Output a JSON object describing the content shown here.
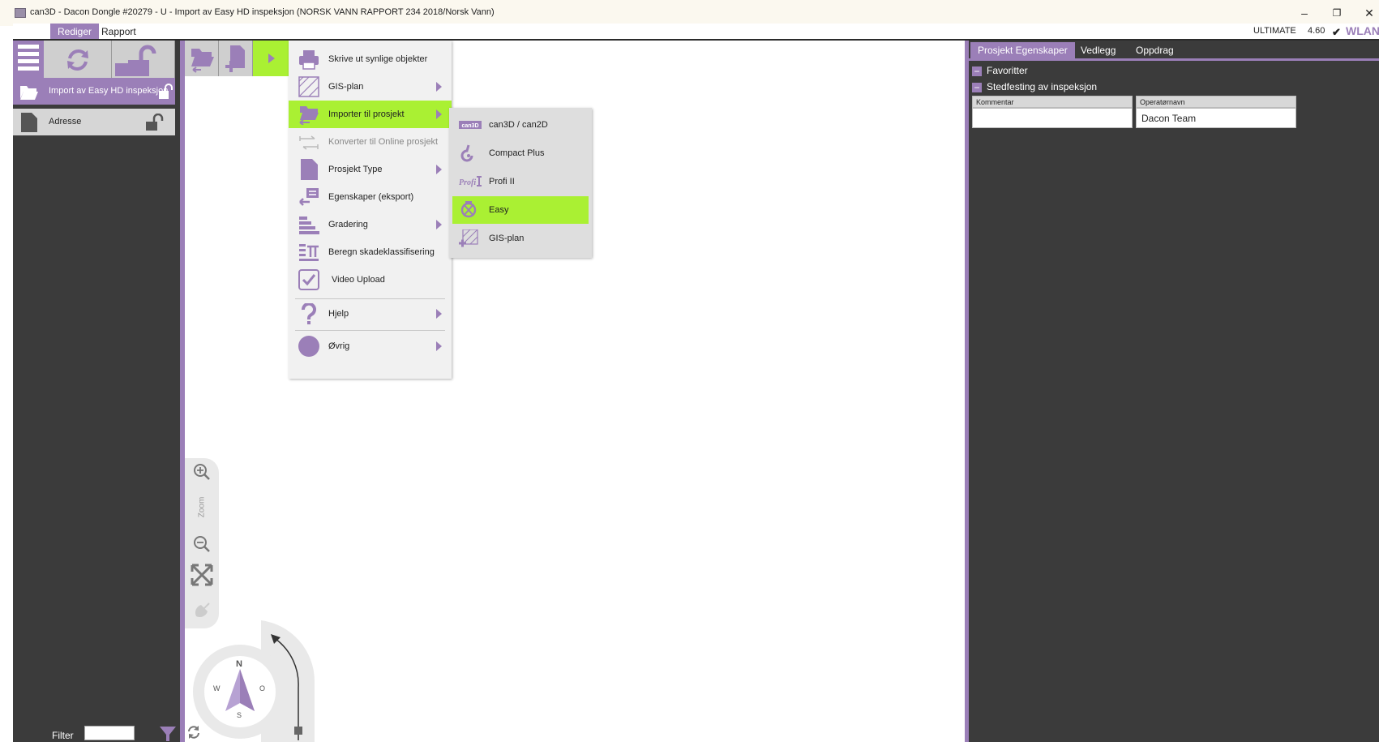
{
  "window": {
    "title": "can3D - Dacon  Dongle #20279 - U - Import av Easy HD inspeksjon (NORSK VANN RAPPORT 234 2018/Norsk Vann)",
    "controls": [
      "–",
      "❐",
      "✕"
    ]
  },
  "ribbon": {
    "tabs": [
      "Rediger",
      "Rapport"
    ],
    "edition": "ULTIMATE",
    "version": "4.60",
    "network": "WLAN"
  },
  "left_panel": {
    "items": [
      {
        "label": "Import av Easy HD inspeksjon",
        "icon": "folder-open-icon",
        "active": true
      },
      {
        "label": "Adresse",
        "icon": "document-icon",
        "active": false
      }
    ],
    "filter_label": "Filter",
    "filter_value": ""
  },
  "main_menu": {
    "items": [
      {
        "label": "Skrive ut synlige objekter",
        "icon": "printer-icon",
        "submenu": false
      },
      {
        "label": "GIS-plan",
        "icon": "gis-plan-icon",
        "submenu": true
      },
      {
        "label": "Importer til prosjekt",
        "icon": "import-icon",
        "submenu": true,
        "highlighted": true
      },
      {
        "label": "Konverter til Online prosjekt",
        "icon": "convert-icon",
        "submenu": false,
        "disabled": true
      },
      {
        "label": "Prosjekt Type",
        "icon": "document-icon",
        "submenu": true
      },
      {
        "label": "Egenskaper (eksport)",
        "icon": "export-properties-icon",
        "submenu": false
      },
      {
        "label": "Gradering",
        "icon": "grading-icon",
        "submenu": true
      },
      {
        "label": "Beregn skadeklassifisering",
        "icon": "calculate-icon",
        "submenu": false
      },
      {
        "label": "Video Upload",
        "icon": "checkbox-icon",
        "submenu": false
      },
      {
        "label": "Hjelp",
        "icon": "question-icon",
        "submenu": true
      },
      {
        "label": "Øvrig",
        "icon": "circle-icon",
        "submenu": true
      }
    ]
  },
  "sub_menu": {
    "items": [
      {
        "label": "can3D / can2D",
        "icon": "can3d-logo-icon"
      },
      {
        "label": "Compact Plus",
        "icon": "compact-plus-icon"
      },
      {
        "label": "Profi II",
        "icon": "profi-logo-icon"
      },
      {
        "label": "Easy",
        "icon": "easy-icon",
        "highlighted": true
      },
      {
        "label": "GIS-plan",
        "icon": "gis-plan-add-icon"
      }
    ]
  },
  "map_controls": {
    "zoom_label": "Zoom",
    "compass": {
      "n": "N",
      "s": "S",
      "w": "W",
      "o": "O"
    }
  },
  "right_panel": {
    "tabs": [
      "Prosjekt Egenskaper",
      "Vedlegg",
      "Oppdrag"
    ],
    "groups": [
      "Favoritter",
      "Stedfesting av inspeksjon"
    ],
    "fields": [
      {
        "label": "Kommentar",
        "value": ""
      },
      {
        "label": "Operatørnavn",
        "value": "Dacon Team"
      }
    ]
  },
  "colors": {
    "accent": "#9b7fb8",
    "highlight": "#aaf033",
    "panel": "#3b3b3b"
  }
}
